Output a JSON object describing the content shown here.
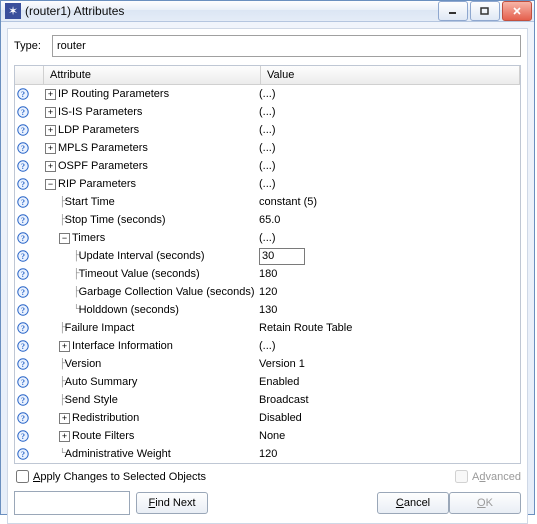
{
  "window": {
    "title": "(router1) Attributes"
  },
  "type": {
    "label": "Type:",
    "value": "router"
  },
  "headers": {
    "attr": "Attribute",
    "val": "Value"
  },
  "rows": [
    {
      "indent": 0,
      "expand": "plus",
      "branch": "",
      "label": "IP Routing Parameters",
      "value": "(...)"
    },
    {
      "indent": 0,
      "expand": "plus",
      "branch": "",
      "label": "IS-IS Parameters",
      "value": "(...)"
    },
    {
      "indent": 0,
      "expand": "plus",
      "branch": "",
      "label": "LDP Parameters",
      "value": "(...)"
    },
    {
      "indent": 0,
      "expand": "plus",
      "branch": "",
      "label": "MPLS Parameters",
      "value": "(...)"
    },
    {
      "indent": 0,
      "expand": "plus",
      "branch": "",
      "label": "OSPF Parameters",
      "value": "(...)"
    },
    {
      "indent": 0,
      "expand": "minus",
      "branch": "",
      "label": "RIP Parameters",
      "value": "(...)"
    },
    {
      "indent": 1,
      "expand": "",
      "branch": "├ ",
      "label": "Start Time",
      "value": "constant (5)"
    },
    {
      "indent": 1,
      "expand": "",
      "branch": "├ ",
      "label": "Stop Time (seconds)",
      "value": "65.0"
    },
    {
      "indent": 1,
      "expand": "minus",
      "branch": "",
      "label": "Timers",
      "value": "(...)"
    },
    {
      "indent": 2,
      "expand": "",
      "branch": "├ ",
      "label": "Update Interval (seconds)",
      "value": "30",
      "editing": true
    },
    {
      "indent": 2,
      "expand": "",
      "branch": "├ ",
      "label": "Timeout Value (seconds)",
      "value": "180"
    },
    {
      "indent": 2,
      "expand": "",
      "branch": "├ ",
      "label": "Garbage Collection Value (seconds)",
      "value": "120"
    },
    {
      "indent": 2,
      "expand": "",
      "branch": "└ ",
      "label": "Holddown (seconds)",
      "value": "130"
    },
    {
      "indent": 1,
      "expand": "",
      "branch": "├ ",
      "label": "Failure Impact",
      "value": "Retain Route Table"
    },
    {
      "indent": 1,
      "expand": "plus",
      "branch": "",
      "label": "Interface Information",
      "value": "(...)"
    },
    {
      "indent": 1,
      "expand": "",
      "branch": "├ ",
      "label": "Version",
      "value": "Version 1"
    },
    {
      "indent": 1,
      "expand": "",
      "branch": "├ ",
      "label": "Auto Summary",
      "value": "Enabled"
    },
    {
      "indent": 1,
      "expand": "",
      "branch": "├ ",
      "label": "Send Style",
      "value": "Broadcast"
    },
    {
      "indent": 1,
      "expand": "plus",
      "branch": "",
      "label": "Redistribution",
      "value": "Disabled"
    },
    {
      "indent": 1,
      "expand": "plus",
      "branch": "",
      "label": "Route Filters",
      "value": "None"
    },
    {
      "indent": 1,
      "expand": "",
      "branch": "└ ",
      "label": "Administrative Weight",
      "value": "120"
    }
  ],
  "footer": {
    "apply": "pply Changes to Selected Objects",
    "advanced": "dvanced",
    "find": "ind Next",
    "cancel": "Cancel",
    "ok": "K"
  }
}
